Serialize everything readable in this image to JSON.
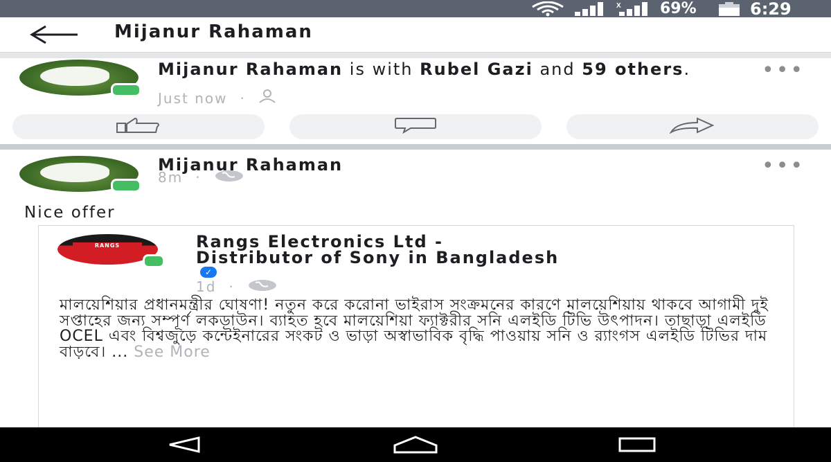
{
  "status_bar": {
    "battery": "69%",
    "time": "6:29",
    "icons": [
      "wifi-icon",
      "signal-icon",
      "signal-no-data-icon",
      "battery-icon"
    ]
  },
  "app_bar": {
    "title": "Mijanur Rahaman"
  },
  "activity_post": {
    "author": "Mijanur Rahaman",
    "with_text": " is with ",
    "tagged_name": "Rubel Gazi",
    "and_text": " and ",
    "others": "59 others",
    "end": ".",
    "time": "Just now",
    "separator": "·",
    "audience_icon": "friends-icon",
    "actions": [
      "like-icon",
      "comment-icon",
      "share-icon"
    ]
  },
  "shared_post": {
    "author": "Mijanur Rahaman",
    "time": "8m",
    "separator": "·",
    "audience_icon": "globe-icon",
    "text": "Nice offer",
    "original": {
      "logo_text": "RANGS",
      "page_name_line1": "Rangs Electronics Ltd -",
      "page_name_line2": "Distributor of Sony in Bangladesh",
      "verified_icon": "check-icon",
      "time": "1d",
      "separator": "·",
      "audience_icon": "globe-icon",
      "body": "মালয়েশিয়ার প্রধানমন্ত্রীর ঘোষণা! নতুন করে করোনা ভাইরাস সংক্রমনের কারণে মালয়েশিয়ায় থাকবে আগামী দুই সপ্তাহের জন্য সম্পূর্ণ লকডাউন। ব্যাহত হবে মালয়েশিয়া ফ্যাক্টরীর সনি এলইডি টিভি উৎপাদন। তাছাড়া এলইডি OCEL এবং বিশ্বজুড়ে কন্টেইনারের সংকট ও ভাড়া অস্বাভাবিক বৃদ্ধি পাওয়ায় সনি ও র‍্যাংগস এলইডি টিভির দাম বাড়বে। ...",
      "see_more": "See More"
    }
  },
  "nav_bar": {
    "icons": [
      "back-triangle-icon",
      "home-icon",
      "recents-icon"
    ]
  },
  "colors": {
    "status_bar": "#5b6370",
    "online": "#45bd62",
    "verified": "#1877f2",
    "secondary_text": "#b0b3b8",
    "logo_red": "#d21d24"
  }
}
